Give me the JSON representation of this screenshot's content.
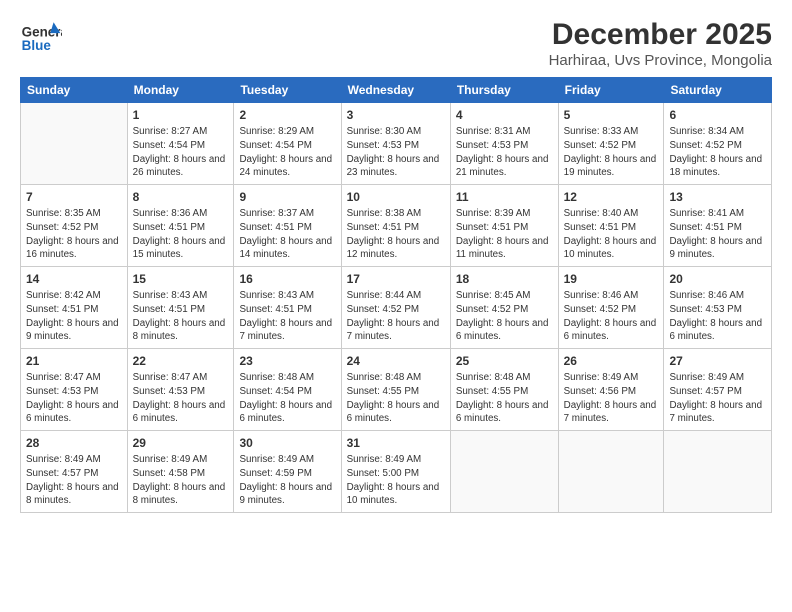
{
  "logo": {
    "general": "General",
    "blue": "Blue"
  },
  "title": "December 2025",
  "subtitle": "Harhiraa, Uvs Province, Mongolia",
  "weekdays": [
    "Sunday",
    "Monday",
    "Tuesday",
    "Wednesday",
    "Thursday",
    "Friday",
    "Saturday"
  ],
  "weeks": [
    [
      {
        "day": "",
        "sunrise": "",
        "sunset": "",
        "daylight": ""
      },
      {
        "day": "1",
        "sunrise": "Sunrise: 8:27 AM",
        "sunset": "Sunset: 4:54 PM",
        "daylight": "Daylight: 8 hours and 26 minutes."
      },
      {
        "day": "2",
        "sunrise": "Sunrise: 8:29 AM",
        "sunset": "Sunset: 4:54 PM",
        "daylight": "Daylight: 8 hours and 24 minutes."
      },
      {
        "day": "3",
        "sunrise": "Sunrise: 8:30 AM",
        "sunset": "Sunset: 4:53 PM",
        "daylight": "Daylight: 8 hours and 23 minutes."
      },
      {
        "day": "4",
        "sunrise": "Sunrise: 8:31 AM",
        "sunset": "Sunset: 4:53 PM",
        "daylight": "Daylight: 8 hours and 21 minutes."
      },
      {
        "day": "5",
        "sunrise": "Sunrise: 8:33 AM",
        "sunset": "Sunset: 4:52 PM",
        "daylight": "Daylight: 8 hours and 19 minutes."
      },
      {
        "day": "6",
        "sunrise": "Sunrise: 8:34 AM",
        "sunset": "Sunset: 4:52 PM",
        "daylight": "Daylight: 8 hours and 18 minutes."
      }
    ],
    [
      {
        "day": "7",
        "sunrise": "Sunrise: 8:35 AM",
        "sunset": "Sunset: 4:52 PM",
        "daylight": "Daylight: 8 hours and 16 minutes."
      },
      {
        "day": "8",
        "sunrise": "Sunrise: 8:36 AM",
        "sunset": "Sunset: 4:51 PM",
        "daylight": "Daylight: 8 hours and 15 minutes."
      },
      {
        "day": "9",
        "sunrise": "Sunrise: 8:37 AM",
        "sunset": "Sunset: 4:51 PM",
        "daylight": "Daylight: 8 hours and 14 minutes."
      },
      {
        "day": "10",
        "sunrise": "Sunrise: 8:38 AM",
        "sunset": "Sunset: 4:51 PM",
        "daylight": "Daylight: 8 hours and 12 minutes."
      },
      {
        "day": "11",
        "sunrise": "Sunrise: 8:39 AM",
        "sunset": "Sunset: 4:51 PM",
        "daylight": "Daylight: 8 hours and 11 minutes."
      },
      {
        "day": "12",
        "sunrise": "Sunrise: 8:40 AM",
        "sunset": "Sunset: 4:51 PM",
        "daylight": "Daylight: 8 hours and 10 minutes."
      },
      {
        "day": "13",
        "sunrise": "Sunrise: 8:41 AM",
        "sunset": "Sunset: 4:51 PM",
        "daylight": "Daylight: 8 hours and 9 minutes."
      }
    ],
    [
      {
        "day": "14",
        "sunrise": "Sunrise: 8:42 AM",
        "sunset": "Sunset: 4:51 PM",
        "daylight": "Daylight: 8 hours and 9 minutes."
      },
      {
        "day": "15",
        "sunrise": "Sunrise: 8:43 AM",
        "sunset": "Sunset: 4:51 PM",
        "daylight": "Daylight: 8 hours and 8 minutes."
      },
      {
        "day": "16",
        "sunrise": "Sunrise: 8:43 AM",
        "sunset": "Sunset: 4:51 PM",
        "daylight": "Daylight: 8 hours and 7 minutes."
      },
      {
        "day": "17",
        "sunrise": "Sunrise: 8:44 AM",
        "sunset": "Sunset: 4:52 PM",
        "daylight": "Daylight: 8 hours and 7 minutes."
      },
      {
        "day": "18",
        "sunrise": "Sunrise: 8:45 AM",
        "sunset": "Sunset: 4:52 PM",
        "daylight": "Daylight: 8 hours and 6 minutes."
      },
      {
        "day": "19",
        "sunrise": "Sunrise: 8:46 AM",
        "sunset": "Sunset: 4:52 PM",
        "daylight": "Daylight: 8 hours and 6 minutes."
      },
      {
        "day": "20",
        "sunrise": "Sunrise: 8:46 AM",
        "sunset": "Sunset: 4:53 PM",
        "daylight": "Daylight: 8 hours and 6 minutes."
      }
    ],
    [
      {
        "day": "21",
        "sunrise": "Sunrise: 8:47 AM",
        "sunset": "Sunset: 4:53 PM",
        "daylight": "Daylight: 8 hours and 6 minutes."
      },
      {
        "day": "22",
        "sunrise": "Sunrise: 8:47 AM",
        "sunset": "Sunset: 4:53 PM",
        "daylight": "Daylight: 8 hours and 6 minutes."
      },
      {
        "day": "23",
        "sunrise": "Sunrise: 8:48 AM",
        "sunset": "Sunset: 4:54 PM",
        "daylight": "Daylight: 8 hours and 6 minutes."
      },
      {
        "day": "24",
        "sunrise": "Sunrise: 8:48 AM",
        "sunset": "Sunset: 4:55 PM",
        "daylight": "Daylight: 8 hours and 6 minutes."
      },
      {
        "day": "25",
        "sunrise": "Sunrise: 8:48 AM",
        "sunset": "Sunset: 4:55 PM",
        "daylight": "Daylight: 8 hours and 6 minutes."
      },
      {
        "day": "26",
        "sunrise": "Sunrise: 8:49 AM",
        "sunset": "Sunset: 4:56 PM",
        "daylight": "Daylight: 8 hours and 7 minutes."
      },
      {
        "day": "27",
        "sunrise": "Sunrise: 8:49 AM",
        "sunset": "Sunset: 4:57 PM",
        "daylight": "Daylight: 8 hours and 7 minutes."
      }
    ],
    [
      {
        "day": "28",
        "sunrise": "Sunrise: 8:49 AM",
        "sunset": "Sunset: 4:57 PM",
        "daylight": "Daylight: 8 hours and 8 minutes."
      },
      {
        "day": "29",
        "sunrise": "Sunrise: 8:49 AM",
        "sunset": "Sunset: 4:58 PM",
        "daylight": "Daylight: 8 hours and 8 minutes."
      },
      {
        "day": "30",
        "sunrise": "Sunrise: 8:49 AM",
        "sunset": "Sunset: 4:59 PM",
        "daylight": "Daylight: 8 hours and 9 minutes."
      },
      {
        "day": "31",
        "sunrise": "Sunrise: 8:49 AM",
        "sunset": "Sunset: 5:00 PM",
        "daylight": "Daylight: 8 hours and 10 minutes."
      },
      {
        "day": "",
        "sunrise": "",
        "sunset": "",
        "daylight": ""
      },
      {
        "day": "",
        "sunrise": "",
        "sunset": "",
        "daylight": ""
      },
      {
        "day": "",
        "sunrise": "",
        "sunset": "",
        "daylight": ""
      }
    ]
  ]
}
